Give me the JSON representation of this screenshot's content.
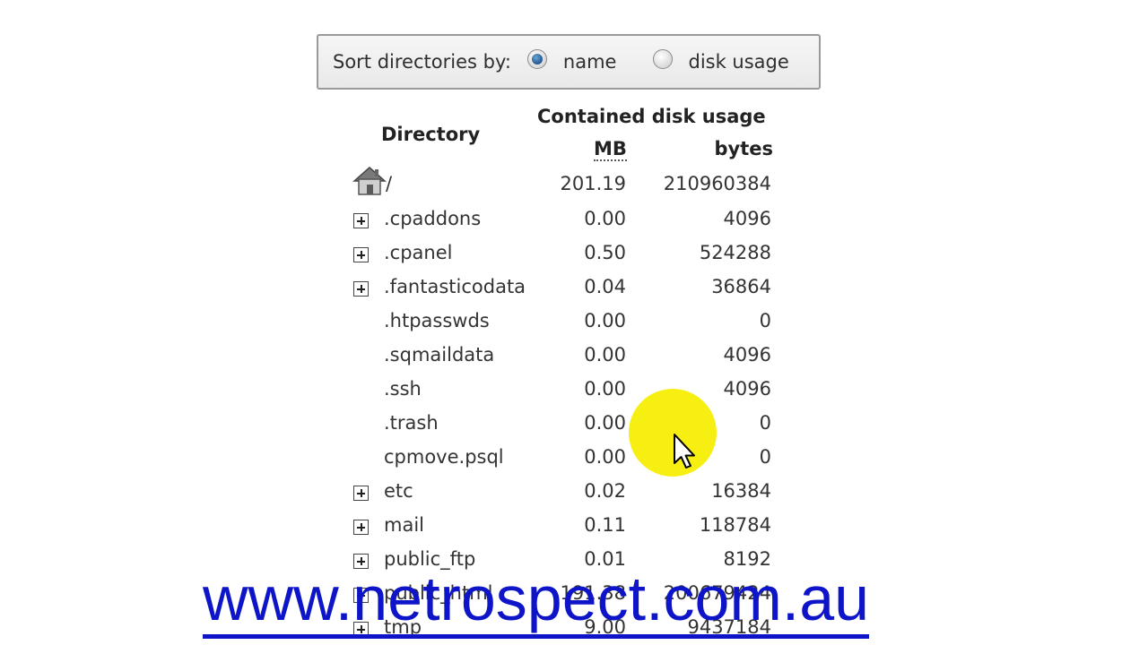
{
  "sort": {
    "label": "Sort directories by:",
    "options": [
      {
        "label": "name",
        "checked": true
      },
      {
        "label": "disk usage",
        "checked": false
      }
    ]
  },
  "table": {
    "header_group": "Contained disk usage",
    "col_directory": "Directory",
    "col_mb": "MB",
    "col_bytes": "bytes",
    "rows": [
      {
        "name": "/",
        "mb": "201.19",
        "bytes": "210960384",
        "expandable": false,
        "home": true
      },
      {
        "name": ".cpaddons",
        "mb": "0.00",
        "bytes": "4096",
        "expandable": true
      },
      {
        "name": ".cpanel",
        "mb": "0.50",
        "bytes": "524288",
        "expandable": true
      },
      {
        "name": ".fantasticodata",
        "mb": "0.04",
        "bytes": "36864",
        "expandable": true
      },
      {
        "name": ".htpasswds",
        "mb": "0.00",
        "bytes": "0",
        "expandable": false
      },
      {
        "name": ".sqmaildata",
        "mb": "0.00",
        "bytes": "4096",
        "expandable": false
      },
      {
        "name": ".ssh",
        "mb": "0.00",
        "bytes": "4096",
        "expandable": false
      },
      {
        "name": ".trash",
        "mb": "0.00",
        "bytes": "0",
        "expandable": false
      },
      {
        "name": "cpmove.psql",
        "mb": "0.00",
        "bytes": "0",
        "expandable": false
      },
      {
        "name": "etc",
        "mb": "0.02",
        "bytes": "16384",
        "expandable": true
      },
      {
        "name": "mail",
        "mb": "0.11",
        "bytes": "118784",
        "expandable": true
      },
      {
        "name": "public_ftp",
        "mb": "0.01",
        "bytes": "8192",
        "expandable": true
      },
      {
        "name": "public_html",
        "mb": "191.38",
        "bytes": "200679424",
        "expandable": true
      },
      {
        "name": "tmp",
        "mb": "9.00",
        "bytes": "9437184",
        "expandable": true
      }
    ]
  },
  "watermark": "www.netrospect.com.au",
  "colors": {
    "watermark": "#0e15c8",
    "cursor_highlight": "#f7ef12",
    "radio_checked": "#1d4f86"
  },
  "icons": {
    "home": "house-icon",
    "expand": "plus-box-icon",
    "cursor": "arrow-cursor-icon"
  }
}
